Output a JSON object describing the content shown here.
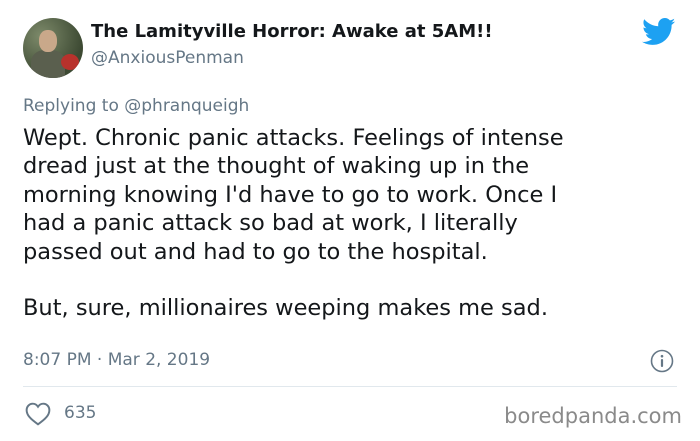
{
  "user": {
    "display_name": "The Lamityville Horror: Awake at 5AM!!",
    "handle": "@AnxiousPenman"
  },
  "reply": {
    "prefix": "Replying to",
    "mention": "@phranqueigh"
  },
  "tweet": {
    "lines": [
      "Wept. Chronic panic attacks. Feelings of intense",
      "dread just at the thought of waking up in the",
      "morning knowing I'd have to go to work. Once I",
      "had a panic attack so bad at work, I literally",
      "passed out and had to go to the hospital.",
      "But, sure, millionaires weeping makes me sad."
    ]
  },
  "meta": {
    "timestamp": "8:07 PM · Mar 2, 2019"
  },
  "actions": {
    "like_count": "635"
  },
  "watermark": "boredpanda.com",
  "colors": {
    "twitter_blue": "#1da1f2",
    "secondary_text": "#657786"
  },
  "icons": {
    "brand": "twitter-bird-icon",
    "info": "info-icon",
    "like": "heart-icon"
  }
}
